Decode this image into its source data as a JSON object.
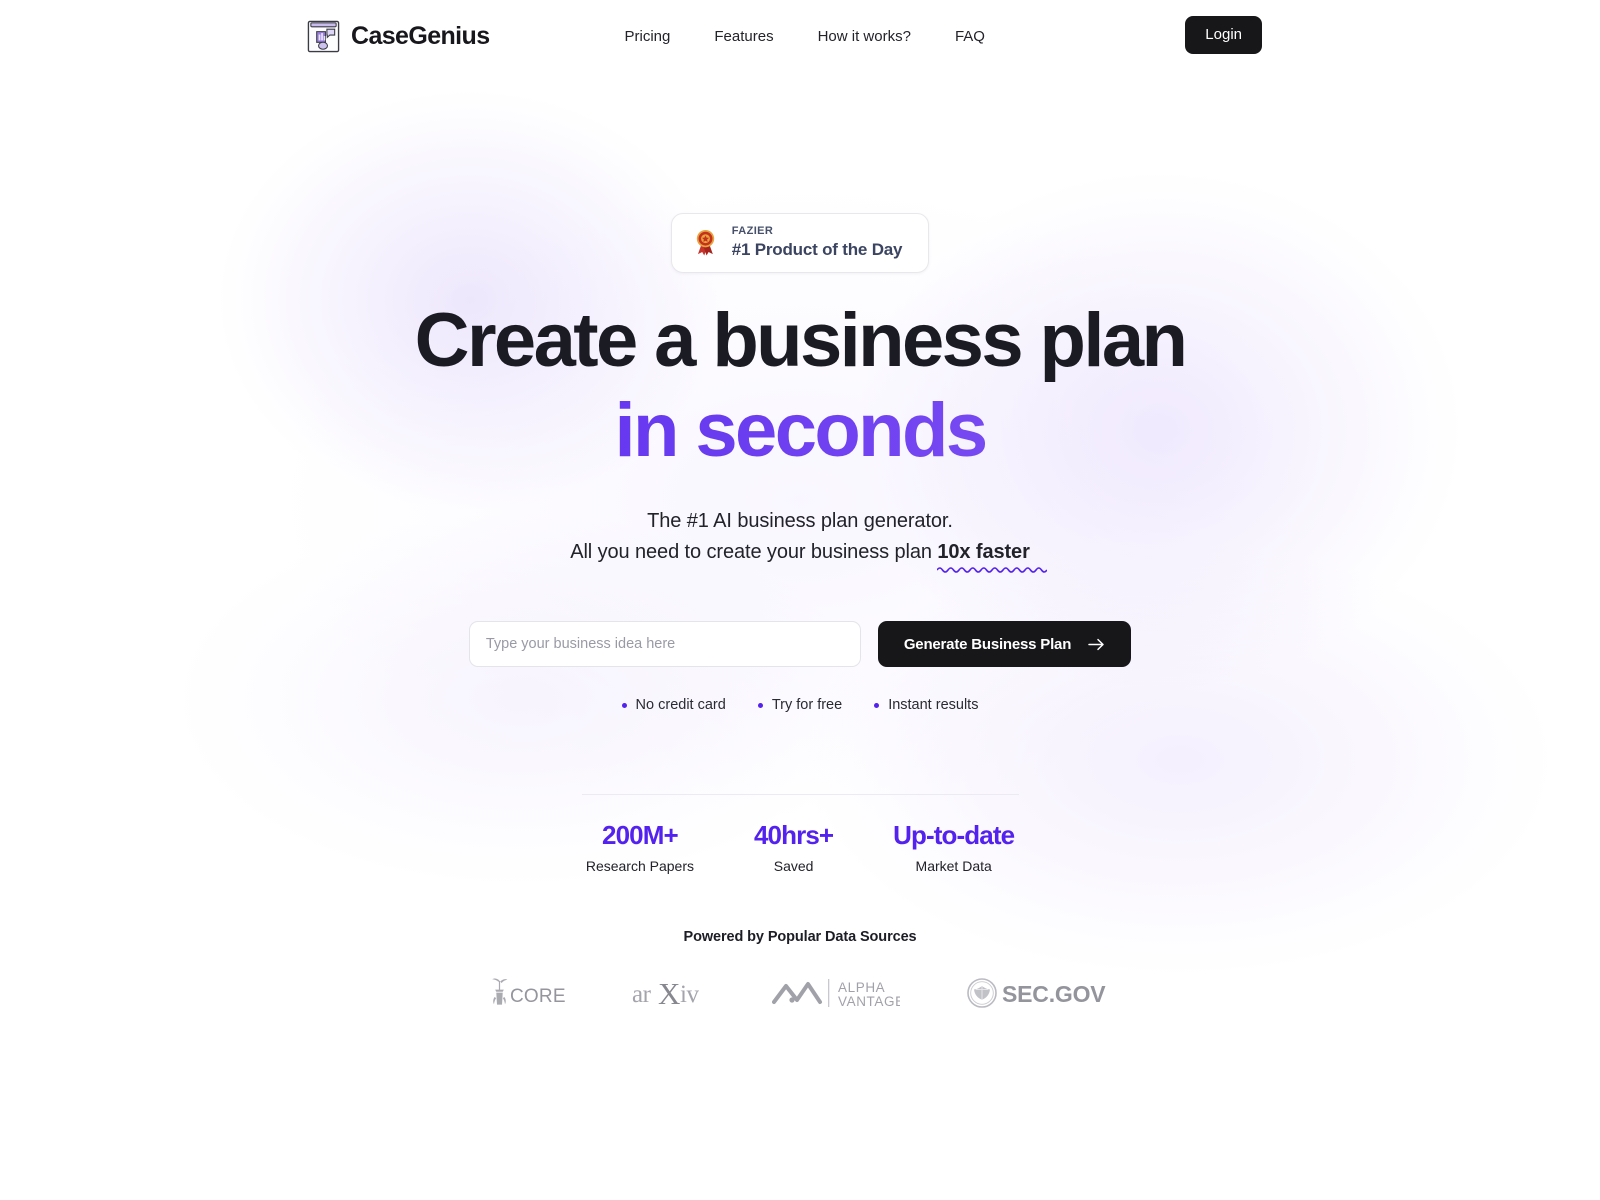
{
  "brand": {
    "name": "CaseGenius",
    "logo_icon": "presentation-chart-icon"
  },
  "nav": {
    "items": [
      {
        "label": "Pricing"
      },
      {
        "label": "Features"
      },
      {
        "label": "How it works?"
      },
      {
        "label": "FAQ"
      }
    ],
    "login_label": "Login"
  },
  "badge": {
    "icon": "medal-rosette-icon",
    "kicker": "FAZIER",
    "title": "#1 Product of the Day"
  },
  "hero": {
    "headline_line1": "Create a business plan",
    "headline_line2": "in seconds",
    "subtitle_line1": "The #1 AI business plan generator.",
    "subtitle_line2_prefix": "All you need to create your business plan ",
    "subtitle_line2_emphasis": "10x faster"
  },
  "form": {
    "placeholder": "Type your business idea here",
    "input_value": "",
    "submit_label": "Generate Business Plan",
    "submit_icon": "arrow-right-icon"
  },
  "bullets": [
    {
      "label": "No credit card"
    },
    {
      "label": "Try for free"
    },
    {
      "label": "Instant results"
    }
  ],
  "stats": [
    {
      "value": "200M+",
      "label": "Research Papers"
    },
    {
      "value": "40hrs+",
      "label": "Saved"
    },
    {
      "value": "Up-to-date",
      "label": "Market Data"
    }
  ],
  "sources": {
    "title": "Powered by Popular Data Sources",
    "logos": [
      {
        "name": "CORE",
        "icon": "core-logo"
      },
      {
        "name": "arXiv",
        "icon": "arxiv-logo"
      },
      {
        "name": "ALPHA VANTAGE",
        "icon": "alpha-vantage-logo"
      },
      {
        "name": "SEC.GOV",
        "icon": "sec-gov-logo"
      }
    ]
  },
  "colors": {
    "accent_purple": "#5322EE",
    "accent_purple_light": "#9367F7",
    "dark": "#17171A",
    "badge_text": "#3B4461",
    "logo_gray": "#9a9aa2"
  }
}
